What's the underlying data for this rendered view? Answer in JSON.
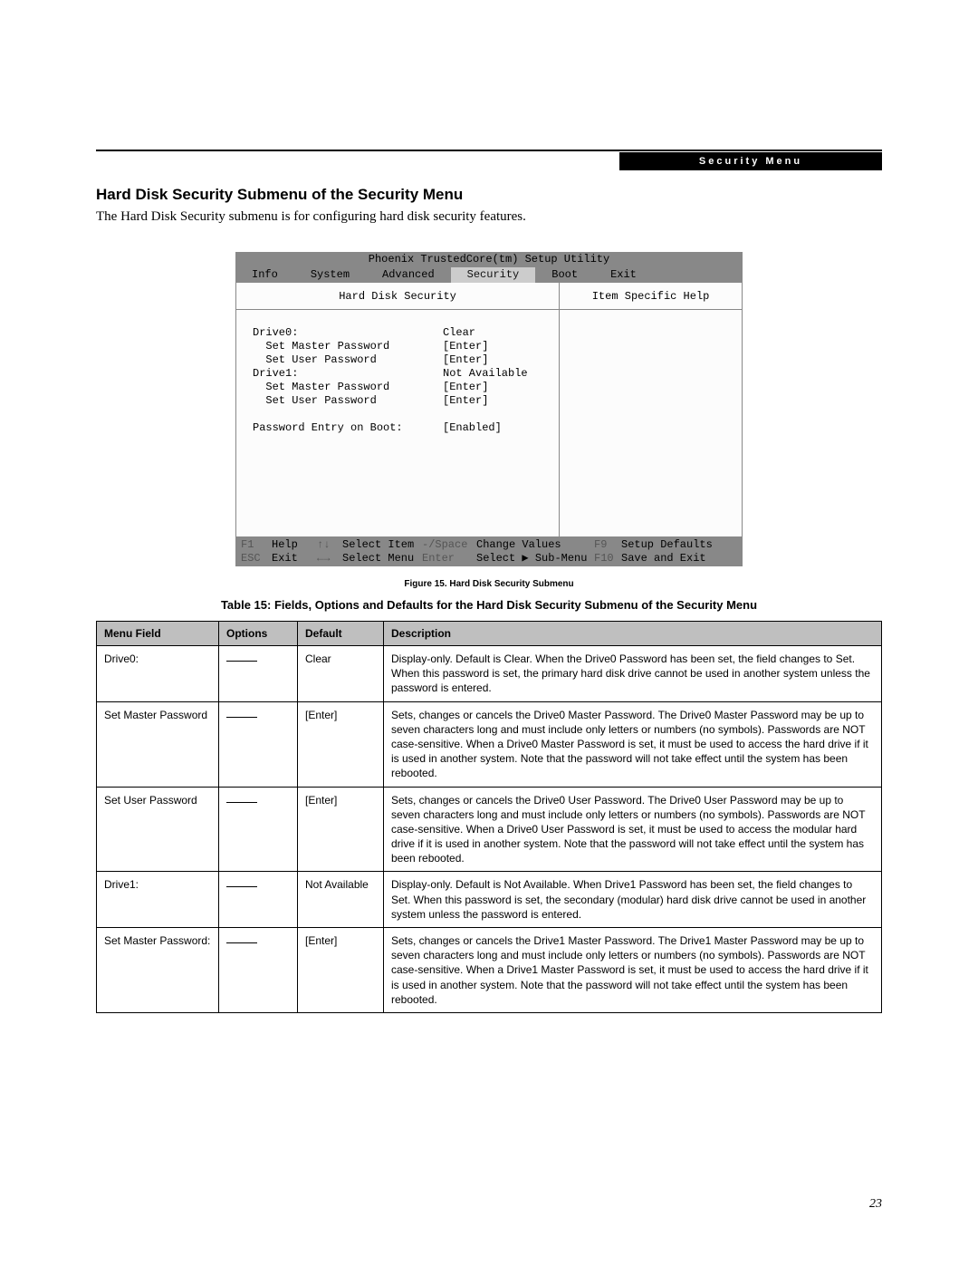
{
  "header": {
    "label": "Security Menu"
  },
  "section": {
    "title": "Hard Disk Security Submenu of the Security Menu",
    "intro": "The Hard Disk Security submenu is for configuring hard disk security features."
  },
  "bios": {
    "title": "Phoenix TrustedCore(tm) Setup Utility",
    "tabs": [
      "Info",
      "System",
      "Advanced",
      "Security",
      "Boot",
      "Exit"
    ],
    "active_tab": "Security",
    "left_heading": "Hard Disk Security",
    "right_heading": "Item Specific Help",
    "items": [
      {
        "indent": 0,
        "label": "Drive0:",
        "value": "Clear"
      },
      {
        "indent": 1,
        "label": "Set Master Password",
        "value": "[Enter]"
      },
      {
        "indent": 1,
        "label": "Set User Password",
        "value": "[Enter]"
      },
      {
        "indent": 0,
        "label": "Drive1:",
        "value": "Not Available"
      },
      {
        "indent": 1,
        "label": "Set Master Password",
        "value": "[Enter]"
      },
      {
        "indent": 1,
        "label": "Set User Password",
        "value": "[Enter]"
      },
      {
        "indent": -1,
        "label": "",
        "value": ""
      },
      {
        "indent": 0,
        "label": "Password Entry on Boot:",
        "value": "[Enabled]"
      }
    ],
    "footer": {
      "row1": {
        "k1": "F1",
        "v1": "Help",
        "k2": "↑↓",
        "v2": "Select Item",
        "k3": "-/Space",
        "v3": "Change Values",
        "k4": "F9",
        "v4": "Setup Defaults"
      },
      "row2": {
        "k1": "ESC",
        "v1": "Exit",
        "k2": "←→",
        "v2": "Select Menu",
        "k3": "Enter",
        "v3": "Select ▶ Sub-Menu",
        "k4": "F10",
        "v4": "Save and Exit"
      }
    }
  },
  "figure_caption": "Figure 15.  Hard Disk Security Submenu",
  "table_caption": "Table 15: Fields, Options and Defaults for the Hard Disk Security Submenu of the Security Menu",
  "table": {
    "headers": [
      "Menu Field",
      "Options",
      "Default",
      "Description"
    ],
    "rows": [
      {
        "field": "Drive0:",
        "options": "—",
        "default": "Clear",
        "desc": "Display-only. Default is Clear. When the Drive0 Password has been set, the field changes to Set. When this password is set, the primary hard disk drive cannot be used in another system unless the password is entered."
      },
      {
        "field": "Set Master Password",
        "options": "—",
        "default": "[Enter]",
        "desc": "Sets, changes or cancels the Drive0 Master Password. The Drive0 Master Password may be up to seven characters long and must include only letters or numbers (no symbols). Passwords are NOT case-sensitive. When a Drive0 Master Password is set, it must be used to access the hard drive if it is used in another system. Note that the password will not take effect until the system has been rebooted."
      },
      {
        "field": "Set User Password",
        "options": "—",
        "default": "[Enter]",
        "desc": "Sets, changes or cancels the Drive0 User Password. The Drive0 User Password may be up to seven characters long and must include only letters or numbers (no symbols). Passwords are NOT case-sensitive. When a Drive0 User Password is set, it must be used to access the modular hard drive if it is used in another system. Note that the password will not take effect until the system has been rebooted."
      },
      {
        "field": "Drive1:",
        "options": "—",
        "default": "Not Available",
        "desc": "Display-only. Default is Not Available. When Drive1 Password has been set, the field changes to Set. When this password is set, the secondary (modular) hard disk drive cannot be used in another system unless the password is entered."
      },
      {
        "field": "Set Master Password:",
        "options": "—",
        "default": "[Enter]",
        "desc": "Sets, changes or cancels the Drive1 Master Password. The Drive1 Master Password may be up to seven characters long and must include only letters or numbers (no symbols). Passwords are NOT case-sensitive. When a Drive1 Master Password is set, it must be used to access the hard drive if it is used in another system. Note that the password will not take effect until the system has been rebooted."
      }
    ]
  },
  "page_number": "23"
}
